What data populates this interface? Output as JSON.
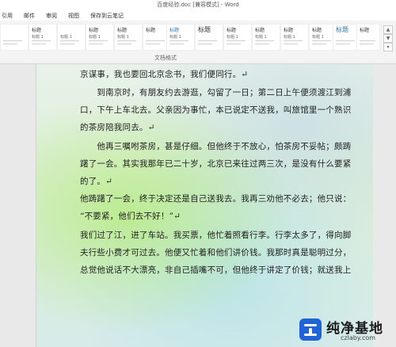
{
  "window": {
    "title": "百度经验.doc [兼容模式] - Word"
  },
  "menu": {
    "items": [
      "引用",
      "邮件",
      "审阅",
      "视图",
      "保存到云笔记"
    ]
  },
  "ribbon": {
    "styles": [
      {
        "title": "",
        "sub": ""
      },
      {
        "title": "标题",
        "sub": "标题 1"
      },
      {
        "title": "",
        "sub": "标题 1"
      },
      {
        "title": "标题",
        "sub": "标题 1"
      },
      {
        "title": "标题",
        "sub": "标题 1"
      },
      {
        "title": "标题",
        "sub": ""
      },
      {
        "title": "标题",
        "sub": "标题 1"
      },
      {
        "title": "标题",
        "sub": ""
      },
      {
        "title": "标题",
        "sub": "标题 1"
      },
      {
        "title": "标题",
        "sub": "标题 1"
      },
      {
        "title": "标题",
        "sub": "标题 1"
      },
      {
        "title": "标题",
        "sub": "标题 1"
      },
      {
        "title": "标题",
        "sub": ""
      },
      {
        "title": "标题",
        "sub": ""
      }
    ],
    "group_label": "文档格式"
  },
  "document": {
    "lines": [
      "京谋事，我也要回北京念书，我们便同行。↵",
      "　　到南京时，有朋友约去游逛，勾留了一日；第二日上午便须渡江到浦",
      "口，下午上车北去。父亲因为事忙，本已说定不送我，叫旅馆里一个熟识",
      "的茶房陪我同去。↵",
      "　　他再三嘱咐茶房，甚是仔细。但他终于不放心，怕茶房不妥帖；颇踌",
      "躇了一会。其实我那年已二十岁，北京已来往过两三次，是没有什么要紧",
      "的了。↵",
      "他踌躇了一会，终于决定还是自己送我去。我再三劝他不必去；他只说：",
      "“不要紧，他们去不好！”↵",
      "我们过了江，进了车站。我买票，他忙着照看行李。行李太多了，得向脚",
      "夫行些小费才可过去。他便又忙着和他们讲价钱。我那时真是聪明过分，",
      "总觉他说话不大漂亮，非自己插嘴不可，但他终于讲定了价钱；就送我上"
    ]
  },
  "watermark": {
    "title": "纯净基地",
    "url": "czlaby.com"
  }
}
